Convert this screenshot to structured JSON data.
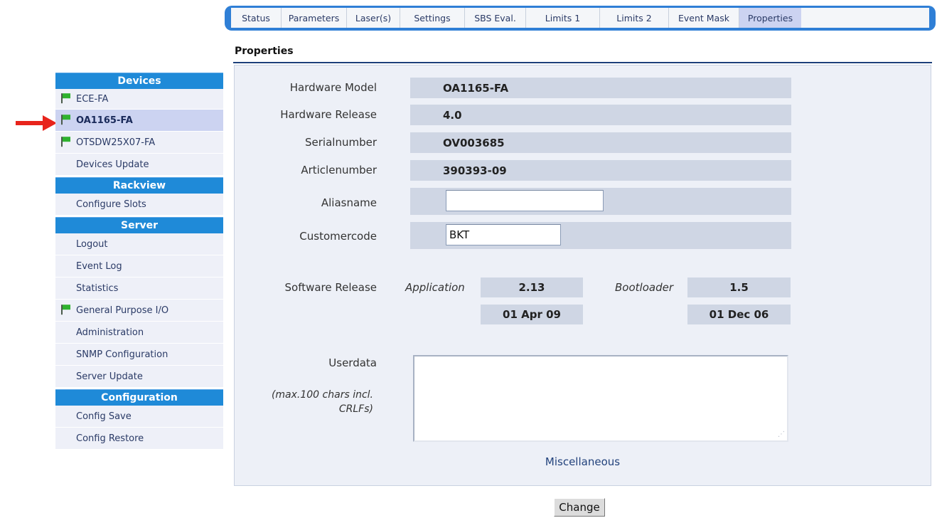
{
  "tabs": [
    {
      "label": "Status"
    },
    {
      "label": "Parameters"
    },
    {
      "label": "Laser(s)"
    },
    {
      "label": "Settings"
    },
    {
      "label": "SBS Eval."
    },
    {
      "label": "Limits 1"
    },
    {
      "label": "Limits 2"
    },
    {
      "label": "Event Mask"
    },
    {
      "label": "Properties"
    }
  ],
  "sidebar": {
    "devices_header": "Devices",
    "devices": [
      {
        "label": "ECE-FA",
        "flag": true
      },
      {
        "label": "OA1165-FA",
        "flag": true,
        "selected": true
      },
      {
        "label": "OTSDW25X07-FA",
        "flag": true
      },
      {
        "label": "Devices Update",
        "flag": false
      }
    ],
    "rackview_header": "Rackview",
    "rackview": [
      {
        "label": "Configure Slots"
      }
    ],
    "server_header": "Server",
    "server": [
      {
        "label": "Logout"
      },
      {
        "label": "Event Log"
      },
      {
        "label": "Statistics"
      },
      {
        "label": "General Purpose I/O",
        "flag": true
      },
      {
        "label": "Administration"
      },
      {
        "label": "SNMP Configuration"
      },
      {
        "label": "Server Update"
      }
    ],
    "configuration_header": "Configuration",
    "configuration": [
      {
        "label": "Config Save"
      },
      {
        "label": "Config Restore"
      }
    ]
  },
  "properties": {
    "title": "Properties",
    "hardware_model_label": "Hardware Model",
    "hardware_model": "OA1165-FA",
    "hardware_release_label": "Hardware Release",
    "hardware_release": "4.0",
    "serialnumber_label": "Serialnumber",
    "serialnumber": "OV003685",
    "articlenumber_label": "Articlenumber",
    "articlenumber": "390393-09",
    "aliasname_label": "Aliasname",
    "aliasname_value": "",
    "customercode_label": "Customercode",
    "customercode_value": "BKT",
    "software_release_label": "Software Release",
    "application_label": "Application",
    "application_version": "2.13",
    "application_date": "01 Apr 09",
    "bootloader_label": "Bootloader",
    "bootloader_version": "1.5",
    "bootloader_date": "01 Dec 06",
    "userdata_label": "Userdata",
    "userdata_hint": "(max.100 chars incl. CRLFs)",
    "userdata_value": "",
    "misc_link": "Miscellaneous",
    "change_button": "Change"
  },
  "colors": {
    "accent": "#1f8ad8",
    "selected_bg": "#ccd3f1",
    "panel_bg": "#edf0f7",
    "flag_green": "#2fb22f",
    "arrow_red": "#e8241c"
  }
}
